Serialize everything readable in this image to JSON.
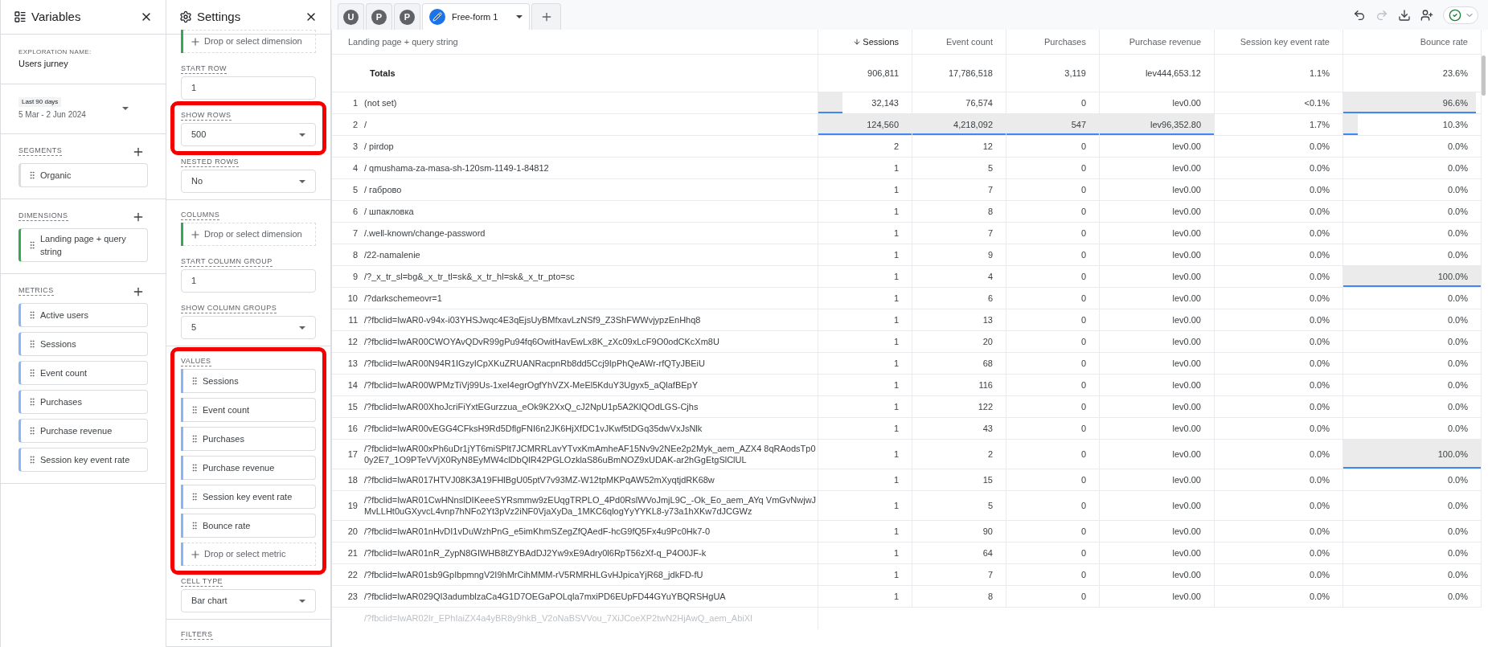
{
  "variables_panel": {
    "title": "Variables",
    "exploration_name_label": "EXPLORATION NAME:",
    "exploration_name": "Users jurney",
    "date_range": {
      "badge": "Last 90 days",
      "dates": "5 Mar - 2 Jun 2024"
    },
    "lists": [
      {
        "label": "SEGMENTS",
        "kind": "segment",
        "items": [
          "Organic"
        ]
      },
      {
        "label": "DIMENSIONS",
        "kind": "dimension",
        "items": [
          "Landing page + query string"
        ]
      },
      {
        "label": "METRICS",
        "kind": "metric",
        "items": [
          "Active users",
          "Sessions",
          "Event count",
          "Purchases",
          "Purchase revenue",
          "Session key event rate"
        ]
      }
    ]
  },
  "settings_panel": {
    "title": "Settings",
    "sections": [
      {
        "blocks": [
          {
            "kind": "drop",
            "color": "#34a853",
            "text": "Drop or select dimension"
          },
          {
            "kind": "field",
            "label": "START ROW",
            "value": "1"
          },
          {
            "kind": "select",
            "label": "SHOW ROWS",
            "value": "500",
            "highlighted": true
          },
          {
            "kind": "select",
            "label": "NESTED ROWS",
            "value": "No"
          }
        ]
      },
      {
        "blocks": [
          {
            "kind": "drop",
            "label": "COLUMNS",
            "color": "#34a853",
            "text": "Drop or select dimension"
          },
          {
            "kind": "field",
            "label": "START COLUMN GROUP",
            "value": "1"
          },
          {
            "kind": "select",
            "label": "SHOW COLUMN GROUPS",
            "value": "5"
          }
        ]
      },
      {
        "blocks": [
          {
            "kind": "chips",
            "label": "VALUES",
            "color": "#8ab4f8",
            "highlighted": true,
            "items": [
              "Sessions",
              "Event count",
              "Purchases",
              "Purchase revenue",
              "Session key event rate",
              "Bounce rate"
            ],
            "drop": "Drop or select metric"
          },
          {
            "kind": "select",
            "label": "CELL TYPE",
            "value": "Bar chart"
          }
        ]
      },
      {
        "blocks": [
          {
            "kind": "heading",
            "label": "FILTERS"
          }
        ]
      }
    ]
  },
  "tabs": [
    {
      "kind": "avatar",
      "text": "U"
    },
    {
      "kind": "avatar",
      "text": "P"
    },
    {
      "kind": "avatar",
      "text": "P"
    },
    {
      "kind": "tab",
      "text": "Free-form 1",
      "selected": true
    },
    {
      "kind": "add"
    }
  ],
  "table": {
    "columns": [
      {
        "text": "Landing page + query string",
        "sorted": false
      },
      {
        "text": "Sessions",
        "sorted": true
      },
      {
        "text": "Event count",
        "sorted": false
      },
      {
        "text": "Purchases",
        "sorted": false
      },
      {
        "text": "Purchase revenue",
        "sorted": false
      },
      {
        "text": "Session key event rate",
        "sorted": false
      },
      {
        "text": "Bounce rate",
        "sorted": false
      }
    ],
    "totals": {
      "label": "Totals",
      "values": [
        "906,811",
        "17,786,518",
        "3,119",
        "lev444,653.12",
        "1.1%",
        "23.6%"
      ]
    },
    "rows": [
      {
        "number": "1",
        "cells": [
          "(not set)",
          {
            "text": "32,143",
            "level": 0.26
          },
          "76,574",
          "0",
          "lev0.00",
          "<0.1%",
          {
            "text": "96.6%",
            "level": 0.966
          }
        ]
      },
      {
        "number": "2",
        "cells": [
          "/",
          {
            "text": "124,560",
            "level": 1
          },
          {
            "text": "4,218,092",
            "level": 1
          },
          {
            "text": "547",
            "level": 1
          },
          {
            "text": "lev96,352.80",
            "level": 1
          },
          "1.7%",
          {
            "text": "10.3%",
            "level": 0.103
          }
        ]
      },
      {
        "number": "3",
        "cells": [
          "/ pirdop",
          "2",
          "12",
          "0",
          "lev0.00",
          "0.0%",
          "0.0%"
        ]
      },
      {
        "number": "4",
        "cells": [
          "/ qmushama-za-masa-sh-120sm-1149-1-84812",
          "1",
          "5",
          "0",
          "lev0.00",
          "0.0%",
          "0.0%"
        ]
      },
      {
        "number": "5",
        "cells": [
          "/ габрово",
          "1",
          "7",
          "0",
          "lev0.00",
          "0.0%",
          "0.0%"
        ]
      },
      {
        "number": "6",
        "cells": [
          "/ шпакловка",
          "1",
          "8",
          "0",
          "lev0.00",
          "0.0%",
          "0.0%"
        ]
      },
      {
        "number": "7",
        "cells": [
          "/.well-known/change-password",
          "1",
          "7",
          "0",
          "lev0.00",
          "0.0%",
          "0.0%"
        ]
      },
      {
        "number": "8",
        "cells": [
          "/22-namalenie",
          "1",
          "9",
          "0",
          "lev0.00",
          "0.0%",
          "0.0%"
        ]
      },
      {
        "number": "9",
        "cells": [
          "/?_x_tr_sl=bg&_x_tr_tl=sk&_x_tr_hl=sk&_x_tr_pto=sc",
          "1",
          "4",
          "0",
          "lev0.00",
          "0.0%",
          {
            "text": "100.0%",
            "level": 1
          }
        ]
      },
      {
        "number": "10",
        "cells": [
          "/?darkschemeovr=1",
          "1",
          "6",
          "0",
          "lev0.00",
          "0.0%",
          "0.0%"
        ]
      },
      {
        "number": "11",
        "cells": [
          "/?fbclid=IwAR0-v94x-i03YHSJwqc4E3qEjsUyBMfxavLzNSf9_Z3ShFWWvjypzEnHhq8",
          "1",
          "13",
          "0",
          "lev0.00",
          "0.0%",
          "0.0%"
        ]
      },
      {
        "number": "12",
        "cells": [
          "/?fbclid=IwAR00CWOYAvQDvR99gPu94fq6OwitHavEwLx8K_zXc09xLcF9O0odCKcXm8U",
          "1",
          "20",
          "0",
          "lev0.00",
          "0.0%",
          "0.0%"
        ]
      },
      {
        "number": "13",
        "cells": [
          "/?fbclid=IwAR00N94R1IGzyICpXKuZRUANRacpnRb8dd5Ccj9IpPhQeAWr-rfQTyJBEiU",
          "1",
          "68",
          "0",
          "lev0.00",
          "0.0%",
          "0.0%"
        ]
      },
      {
        "number": "14",
        "cells": [
          "/?fbclid=IwAR00WPMzTiVj99Us-1xeI4egrOgfYhVZX-MeEl5KduY3Ugyx5_aQlafBEpY",
          "1",
          "116",
          "0",
          "lev0.00",
          "0.0%",
          "0.0%"
        ]
      },
      {
        "number": "15",
        "cells": [
          "/?fbclid=IwAR00XhoJcriFiYxtEGurzzua_eOk9K2XxQ_cJ2NpU1p5A2KlQOdLGS-Cjhs",
          "1",
          "122",
          "0",
          "lev0.00",
          "0.0%",
          "0.0%"
        ]
      },
      {
        "number": "16",
        "cells": [
          "/?fbclid=IwAR00vEGG4CFksH9Rd5DflgFNI6n2JK6HjXfDC1vJKwf5tDGq35dwVxJsNlk",
          "1",
          "43",
          "0",
          "lev0.00",
          "0.0%",
          "0.0%"
        ]
      },
      {
        "number": "17",
        "cells": [
          "/?fbclid=IwAR00xPh6uDr1jYT6miSPlt7JCMRRLavYTvxKmAmheAF15Nv9v2NEe2p2Myk_aem_AZX4 8qRAodsTp00y2E7_1O9PTeVVjX0RyN8EyMW4clDbQlR42PGLOzklaS86uBmNOZ9xUDAK-ar2hGgEtgSlClUL",
          "1",
          "2",
          "0",
          "lev0.00",
          "0.0%",
          {
            "text": "100.0%",
            "level": 1
          }
        ]
      },
      {
        "number": "18",
        "cells": [
          "/?fbclid=IwAR017HTVJ08K3A19FHlBgU05ptV7v93MZ-W12tpMKPqAW52mXyqtjdRK68w",
          "1",
          "15",
          "0",
          "lev0.00",
          "0.0%",
          "0.0%"
        ]
      },
      {
        "number": "19",
        "cells": [
          "/?fbclid=IwAR01CwHNnslDIKeeeSYRsmmw9zEUqgTRPLO_4Pd0RslWVoJmjL9C_-Ok_Eo_aem_AYq VmGvNwjwJMvLLHt0uGXyvcL4vnp7hNFo2Yt3pVz2iNF0VjaXyDa_1MKC6qlogYyYYKL8-y73a1hXKw7dJCGWz",
          "1",
          "5",
          "0",
          "lev0.00",
          "0.0%",
          "0.0%"
        ]
      },
      {
        "number": "20",
        "cells": [
          "/?fbclid=IwAR01nHvDI1vDuWzhPnG_e5imKhmSZegZfQAedF-hcG9fQ5Fx4u9Pc0Hk7-0",
          "1",
          "90",
          "0",
          "lev0.00",
          "0.0%",
          "0.0%"
        ]
      },
      {
        "number": "21",
        "cells": [
          "/?fbclid=IwAR01nR_ZypN8GIWHB8tZYBAdDJ2Yw9xE9Adry0l6RpT56zXf-q_P4O0JF-k",
          "1",
          "64",
          "0",
          "lev0.00",
          "0.0%",
          "0.0%"
        ]
      },
      {
        "number": "22",
        "cells": [
          "/?fbclid=IwAR01sb9GpIbpmngV2I9hMrCihMMM-rV5RMRHLGvHJpicaYjR68_jdkFD-fU",
          "1",
          "7",
          "0",
          "lev0.00",
          "0.0%",
          "0.0%"
        ]
      },
      {
        "number": "23",
        "cells": [
          "/?fbclid=IwAR029QI3adumblzaCa4G1D7OEGaPOLqla7mxiPD6EUpFD44GYuYBQRSHgUA",
          "1",
          "8",
          "0",
          "lev0.00",
          "0.0%",
          "0.0%"
        ]
      }
    ],
    "partial_row": {
      "page": "/?fbclid=IwAR02Ir_EPhIaiZX4a4yBR8y9hkB_V2oNaBSVVou_7XiJCoeXP2twN2HjAwQ_aem_AbiXI"
    }
  }
}
